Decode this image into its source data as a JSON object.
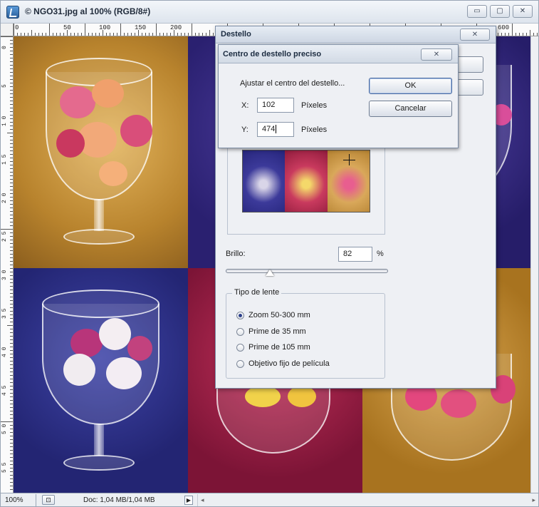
{
  "window": {
    "title": "© NGO31.jpg al 100% (RGB/8#)",
    "controls": {
      "minimize": "▭",
      "maximize": "▢",
      "close": "✕"
    }
  },
  "ruler": {
    "top_labels": [
      "0",
      "50",
      "100",
      "150",
      "200",
      "600"
    ],
    "left_labels": [
      "0",
      "5",
      "1 0",
      "1 5",
      "2 0",
      "2 5",
      "3 0",
      "3 5",
      "4 0",
      "4 5",
      "5 0",
      "5 5"
    ]
  },
  "status": {
    "zoom": "100%",
    "doc_info": "Doc: 1,04 MB/1,04 MB"
  },
  "dialog": {
    "title": "Destello",
    "close_label": "✕",
    "brillo_label": "Brillo:",
    "brillo_value": "82",
    "brillo_unit": "%",
    "brillo_level_percent": 27,
    "lens_group_label": "Tipo de lente",
    "lens_options": [
      {
        "label": "Zoom 50-300 mm",
        "checked": true
      },
      {
        "label": "Prime de 35 mm",
        "checked": false
      },
      {
        "label": "Prime de 105 mm",
        "checked": false
      },
      {
        "label": "Objetivo fijo de película",
        "checked": false
      }
    ]
  },
  "subdialog": {
    "title": "Centro de destello preciso",
    "close_label": "✕",
    "description": "Ajustar el centro del destello...",
    "x_label": "X:",
    "x_value": "102",
    "y_label": "Y:",
    "y_value": "474",
    "unit": "Píxeles",
    "ok_label": "OK",
    "cancel_label": "Cancelar"
  },
  "icons": {
    "app": "photoshop-document-icon",
    "crosshair": "crosshair-icon"
  }
}
